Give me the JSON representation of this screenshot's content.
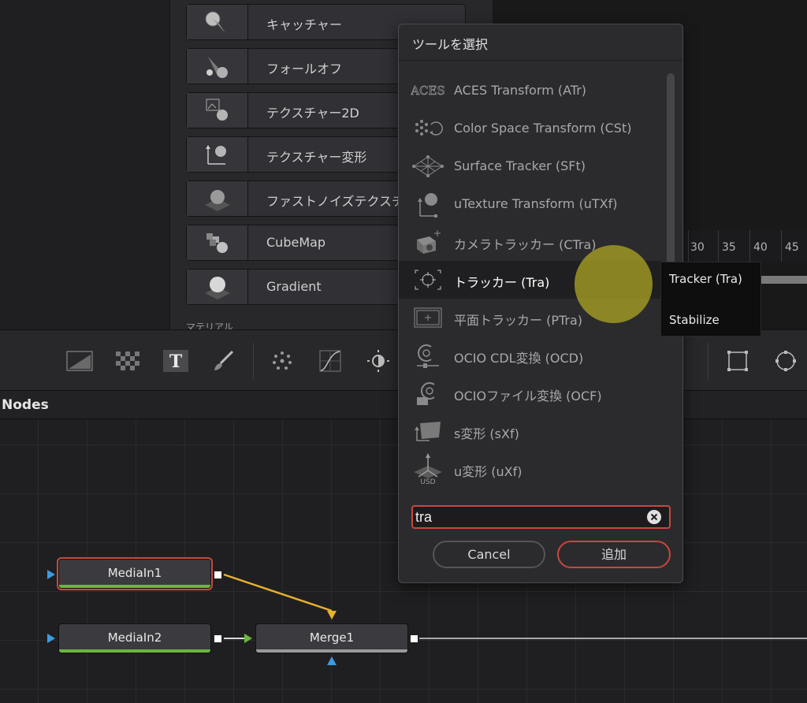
{
  "library": {
    "items": [
      {
        "label": "キャッチャー",
        "icon": "catcher-icon"
      },
      {
        "label": "フォールオフ",
        "icon": "falloff-icon"
      },
      {
        "label": "テクスチャー2D",
        "icon": "texture2d-icon"
      },
      {
        "label": "テクスチャー変形",
        "icon": "texture-transform-icon"
      },
      {
        "label": "ファストノイズテクスチャー",
        "icon": "fast-noise-icon"
      },
      {
        "label": "CubeMap",
        "icon": "cubemap-icon"
      },
      {
        "label": "Gradient",
        "icon": "gradient-icon"
      }
    ],
    "section_label": "マテリアル"
  },
  "timeline": {
    "ticks": [
      "30",
      "35",
      "40",
      "45"
    ]
  },
  "toolbar": {
    "icons": [
      "background-icon",
      "checker-icon",
      "text-icon",
      "paint-icon",
      "particles-icon",
      "curves-icon",
      "brightness-contrast-icon",
      "rectangle-icon",
      "ellipse-icon"
    ]
  },
  "nodes_panel": {
    "title": "Nodes",
    "nodes": [
      {
        "name": "MediaIn1"
      },
      {
        "name": "MediaIn2"
      },
      {
        "name": "Merge1"
      }
    ]
  },
  "dialog": {
    "title": "ツールを選択",
    "tools": [
      {
        "label": "ACES Transform (ATr)",
        "icon": "aces-icon"
      },
      {
        "label": "Color Space Transform (CSt)",
        "icon": "color-space-icon"
      },
      {
        "label": "Surface Tracker (SFt)",
        "icon": "surface-tracker-icon"
      },
      {
        "label": "uTexture Transform (uTXf)",
        "icon": "utexture-icon"
      },
      {
        "label": "カメラトラッカー (CTra)",
        "icon": "camera-tracker-icon"
      },
      {
        "label": "トラッカー (Tra)",
        "icon": "tracker-icon"
      },
      {
        "label": "平面トラッカー (PTra)",
        "icon": "planar-tracker-icon"
      },
      {
        "label": "OCIO CDL変換 (OCD)",
        "icon": "ocio-cdl-icon"
      },
      {
        "label": "OCIOファイル変換 (OCF)",
        "icon": "ocio-file-icon"
      },
      {
        "label": "s変形 (sXf)",
        "icon": "stransform-icon"
      },
      {
        "label": "u変形 (uXf)",
        "icon": "utransform-icon"
      }
    ],
    "selected_index": 5,
    "search": {
      "value": "tra"
    },
    "cancel_label": "Cancel",
    "add_label": "追加",
    "aces_icon_text": "ACES",
    "usd_icon_text": "USD"
  },
  "submenu": {
    "items": [
      "Tracker (Tra)",
      "Stabilize"
    ]
  },
  "colors": {
    "accent_red": "#c9473b",
    "link_yellow": "#e8b12e",
    "port_blue": "#3b9be0",
    "port_green": "#69b83a",
    "cursor_highlight": "#afa523"
  }
}
